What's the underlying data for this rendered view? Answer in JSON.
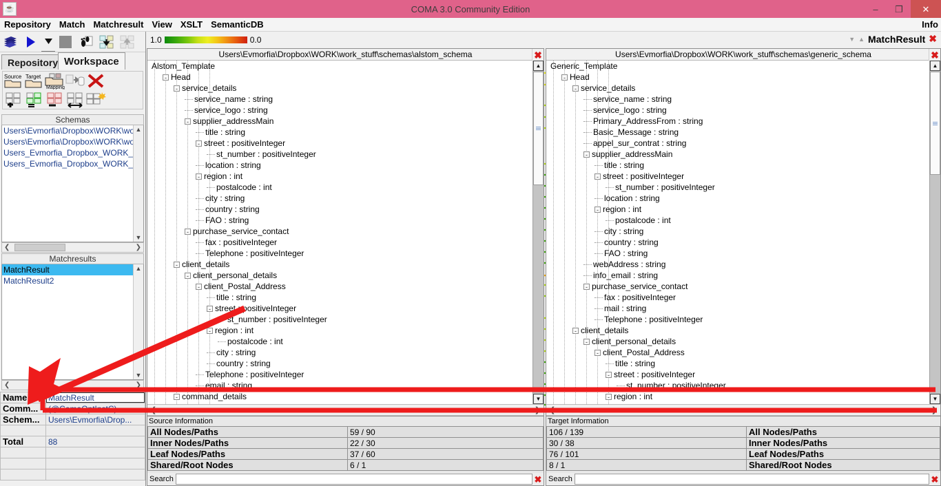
{
  "window": {
    "title": "COMA 3.0 Community Edition",
    "app_icon": "java-coffee-icon",
    "minimize": "–",
    "maximize": "❐",
    "close": "✕"
  },
  "menubar": {
    "items": [
      "Repository",
      "Match",
      "Matchresult",
      "View",
      "XSLT",
      "SemanticDB"
    ],
    "right_item": "Info"
  },
  "toolbar": {
    "buttons": [
      {
        "name": "repository-icon",
        "glyph": "⌸"
      },
      {
        "name": "run-match-icon",
        "glyph": "▶"
      },
      {
        "name": "dropdown-arrow-icon",
        "glyph": "▼"
      },
      {
        "name": "stop-icon",
        "glyph": "■"
      },
      {
        "name": "footprint-icon",
        "glyph": "❧"
      },
      {
        "name": "import-schema-icon",
        "glyph": "⬇"
      },
      {
        "name": "export-schema-icon",
        "glyph": "⬆"
      }
    ]
  },
  "tabs": {
    "repository": "Repository",
    "workspace": "Workspace",
    "active": "Workspace"
  },
  "workspace_tools": {
    "row1": [
      {
        "name": "open-source-icon",
        "label": "Source"
      },
      {
        "name": "open-target-icon",
        "label": "Target"
      },
      {
        "name": "open-mapping-icon",
        "label": "Mapping"
      },
      {
        "name": "save-to-db-icon",
        "label": ""
      },
      {
        "name": "delete-icon",
        "label": ""
      }
    ],
    "row2": [
      {
        "name": "add-mapping-icon",
        "label": ""
      },
      {
        "name": "compare-equal-icon",
        "label": ""
      },
      {
        "name": "diff-mapping-icon",
        "label": ""
      },
      {
        "name": "swap-mapping-icon",
        "label": ""
      },
      {
        "name": "new-mapping-icon",
        "label": ""
      }
    ]
  },
  "schemas": {
    "header": "Schemas",
    "items": [
      "Users\\Evmorfia\\Dropbox\\WORK\\work_",
      "Users\\Evmorfia\\Dropbox\\WORK\\work_",
      "Users_Evmorfia_Dropbox_WORK_wor",
      "Users_Evmorfia_Dropbox_WORK_wor"
    ]
  },
  "matchresults": {
    "header": "Matchresults",
    "items": [
      "MatchResult",
      "MatchResult2"
    ],
    "selected": "MatchResult"
  },
  "properties": {
    "rows": [
      {
        "key": "Name",
        "value": "MatchResult",
        "is_input": true
      },
      {
        "key": "Comm...",
        "value": "(@ComaOptInstC)",
        "is_input": false
      },
      {
        "key": "Schem...",
        "value": "Users\\Evmorfia\\Drop...",
        "is_input": false
      },
      {
        "key": "",
        "value": "",
        "is_input": false
      },
      {
        "key": "Total",
        "value": "88",
        "is_input": false
      },
      {
        "key": "",
        "value": "",
        "is_input": false
      },
      {
        "key": "",
        "value": "",
        "is_input": false
      },
      {
        "key": "",
        "value": "",
        "is_input": false
      }
    ]
  },
  "legend": {
    "high": "1.0",
    "low": "0.0",
    "gradient_colors": [
      "#0c8a0c",
      "#79c70c",
      "#eeee22",
      "#f08c14",
      "#cf1f10"
    ]
  },
  "matchresult_header": {
    "title": "MatchResult",
    "collapse_icon": "▼",
    "expand_icon": "▲"
  },
  "source_pane": {
    "path": "Users\\Evmorfia\\Dropbox\\WORK\\work_stuff\\schemas\\alstom_schema",
    "close_icon": "✖",
    "root": "Alstom_Template",
    "tree": [
      {
        "label": "Alstom_Template",
        "depth": 0,
        "expander": ""
      },
      {
        "label": "Head",
        "depth": 1,
        "expander": "-"
      },
      {
        "label": "service_details",
        "depth": 2,
        "expander": "-"
      },
      {
        "label": "service_name : string",
        "depth": 3,
        "expander": ""
      },
      {
        "label": "service_logo : string",
        "depth": 3,
        "expander": ""
      },
      {
        "label": "supplier_addressMain",
        "depth": 3,
        "expander": "-"
      },
      {
        "label": "title : string",
        "depth": 4,
        "expander": ""
      },
      {
        "label": "street : positiveInteger",
        "depth": 4,
        "expander": "-"
      },
      {
        "label": "st_number : positiveInteger",
        "depth": 5,
        "expander": ""
      },
      {
        "label": "location : string",
        "depth": 4,
        "expander": ""
      },
      {
        "label": "region : int",
        "depth": 4,
        "expander": "-"
      },
      {
        "label": "postalcode : int",
        "depth": 5,
        "expander": ""
      },
      {
        "label": "city : string",
        "depth": 4,
        "expander": ""
      },
      {
        "label": "country : string",
        "depth": 4,
        "expander": ""
      },
      {
        "label": "FAO : string",
        "depth": 4,
        "expander": ""
      },
      {
        "label": "purchase_service_contact",
        "depth": 3,
        "expander": "-"
      },
      {
        "label": "fax : positiveInteger",
        "depth": 4,
        "expander": ""
      },
      {
        "label": "Telephone : positiveInteger",
        "depth": 4,
        "expander": ""
      },
      {
        "label": "client_details",
        "depth": 2,
        "expander": "-"
      },
      {
        "label": "client_personal_details",
        "depth": 3,
        "expander": "-"
      },
      {
        "label": "client_Postal_Address",
        "depth": 4,
        "expander": "-"
      },
      {
        "label": "title : string",
        "depth": 5,
        "expander": ""
      },
      {
        "label": "street : positiveInteger",
        "depth": 5,
        "expander": "-"
      },
      {
        "label": "st_number : positiveInteger",
        "depth": 6,
        "expander": ""
      },
      {
        "label": "region : int",
        "depth": 5,
        "expander": "-"
      },
      {
        "label": "postalcode : int",
        "depth": 6,
        "expander": ""
      },
      {
        "label": "city : string",
        "depth": 5,
        "expander": ""
      },
      {
        "label": "country : string",
        "depth": 5,
        "expander": ""
      },
      {
        "label": "Telephone : positiveInteger",
        "depth": 4,
        "expander": ""
      },
      {
        "label": "email : string",
        "depth": 4,
        "expander": ""
      },
      {
        "label": "command_details",
        "depth": 2,
        "expander": "-"
      }
    ],
    "info_label": "Source Information",
    "stats": [
      {
        "label": "All Nodes/Paths",
        "value": "59 / 90"
      },
      {
        "label": "Inner Nodes/Paths",
        "value": "22 / 30"
      },
      {
        "label": "Leaf Nodes/Paths",
        "value": "37 / 60"
      },
      {
        "label": "Shared/Root Nodes",
        "value": "6 / 1"
      }
    ],
    "search_label": "Search",
    "search_value": "",
    "search_clear_icon": "✖"
  },
  "target_pane": {
    "path": "Users\\Evmorfia\\Dropbox\\WORK\\work_stuff\\schemas\\generic_schema",
    "close_icon": "✖",
    "root": "Generic_Template",
    "tree": [
      {
        "label": "Generic_Template",
        "depth": 0,
        "expander": ""
      },
      {
        "label": "Head",
        "depth": 1,
        "expander": "-"
      },
      {
        "label": "service_details",
        "depth": 2,
        "expander": "-"
      },
      {
        "label": "service_name : string",
        "depth": 3,
        "expander": ""
      },
      {
        "label": "service_logo : string",
        "depth": 3,
        "expander": ""
      },
      {
        "label": "Primary_AddressFrom : string",
        "depth": 3,
        "expander": ""
      },
      {
        "label": "Basic_Message : string",
        "depth": 3,
        "expander": ""
      },
      {
        "label": "appel_sur_contrat : string",
        "depth": 3,
        "expander": ""
      },
      {
        "label": "supplier_addressMain",
        "depth": 3,
        "expander": "-"
      },
      {
        "label": "title : string",
        "depth": 4,
        "expander": ""
      },
      {
        "label": "street : positiveInteger",
        "depth": 4,
        "expander": "-"
      },
      {
        "label": "st_number : positiveInteger",
        "depth": 5,
        "expander": ""
      },
      {
        "label": "location : string",
        "depth": 4,
        "expander": ""
      },
      {
        "label": "region : int",
        "depth": 4,
        "expander": "-"
      },
      {
        "label": "postalcode : int",
        "depth": 5,
        "expander": ""
      },
      {
        "label": "city : string",
        "depth": 4,
        "expander": ""
      },
      {
        "label": "country : string",
        "depth": 4,
        "expander": ""
      },
      {
        "label": "FAO : string",
        "depth": 4,
        "expander": ""
      },
      {
        "label": "webAddress : string",
        "depth": 3,
        "expander": ""
      },
      {
        "label": "info_email : string",
        "depth": 3,
        "expander": ""
      },
      {
        "label": "purchase_service_contact",
        "depth": 3,
        "expander": "-"
      },
      {
        "label": "fax : positiveInteger",
        "depth": 4,
        "expander": ""
      },
      {
        "label": "mail : string",
        "depth": 4,
        "expander": ""
      },
      {
        "label": "Telephone : positiveInteger",
        "depth": 4,
        "expander": ""
      },
      {
        "label": "client_details",
        "depth": 2,
        "expander": "-"
      },
      {
        "label": "client_personal_details",
        "depth": 3,
        "expander": "-"
      },
      {
        "label": "client_Postal_Address",
        "depth": 4,
        "expander": "-"
      },
      {
        "label": "title : string",
        "depth": 5,
        "expander": ""
      },
      {
        "label": "street : positiveInteger",
        "depth": 5,
        "expander": "-"
      },
      {
        "label": "st_number : positiveInteger",
        "depth": 6,
        "expander": ""
      },
      {
        "label": "region : int",
        "depth": 5,
        "expander": "-"
      }
    ],
    "info_label": "Target Information",
    "stats": [
      {
        "label": "All Nodes/Paths",
        "value": "106 / 139"
      },
      {
        "label": "Inner Nodes/Paths",
        "value": "30 / 38"
      },
      {
        "label": "Leaf Nodes/Paths",
        "value": "76 / 101"
      },
      {
        "label": "Shared/Root Nodes",
        "value": "8 / 1"
      }
    ],
    "search_label": "Search",
    "search_value": "",
    "search_clear_icon": "✖"
  },
  "annotation": {
    "color": "#ee1c1c",
    "shapes": [
      "arrow-pointing-to-name-field",
      "rectangle-around-name-field"
    ]
  }
}
